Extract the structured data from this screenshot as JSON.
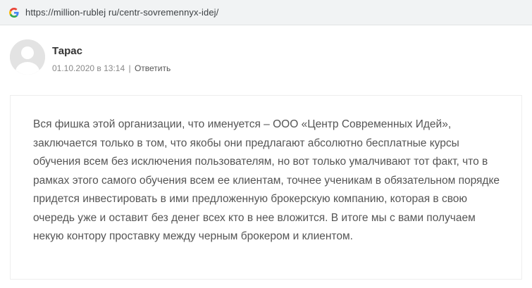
{
  "browser": {
    "favicon": "google-g-icon",
    "url": "https://million-rublej ru/centr-sovremennyx-idej/"
  },
  "comment": {
    "avatar": "default-user-avatar",
    "author": "Тарас",
    "date_time": "01.10.2020 в 13:14",
    "separator": "|",
    "reply_label": "Ответить",
    "text": "Вся фишка этой организации, что именуется – ООО «Центр Современных Идей», заключается только в том, что якобы они предлагают абсолютно бесплатные курсы обучения всем без исключения пользователям, но вот только умалчивают тот факт, что в рамках этого самого обучения всем ее клиентам, точнее ученикам в обязательном порядке придется инвестировать в ими предложенную брокерскую компанию, которая в свою очередь уже и оставит без денег всех кто в нее вложится. В итоге мы с вами получаем некую контору проставку между черным брокером и клиентом."
  },
  "colors": {
    "author": "#333333",
    "meta": "#888888",
    "body_text": "#555555",
    "url_bar_bg": "#f1f3f4"
  }
}
